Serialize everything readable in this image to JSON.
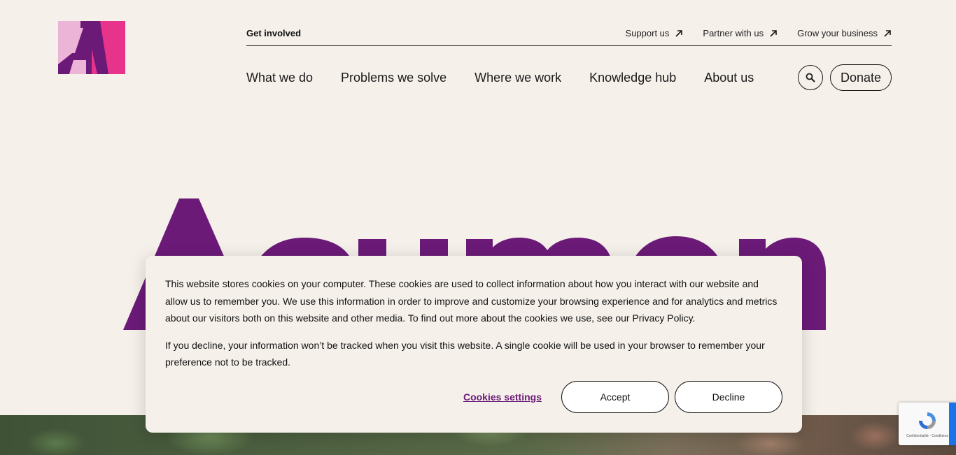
{
  "brand": {
    "name": "Acumen",
    "colors": {
      "purple": "#6b1a78",
      "pink": "#e8338b",
      "light_pink": "#ecb5d8",
      "bg": "#f5f0ea"
    }
  },
  "utility_nav": {
    "get_involved": "Get involved",
    "links": [
      {
        "label": "Support us",
        "icon": "arrow-up-right-icon"
      },
      {
        "label": "Partner with us",
        "icon": "arrow-up-right-icon"
      },
      {
        "label": "Grow your business",
        "icon": "arrow-up-right-icon"
      }
    ]
  },
  "main_nav": {
    "items": [
      "What we do",
      "Problems we solve",
      "Where we work",
      "Knowledge hub",
      "About us"
    ],
    "search_icon": "search-icon",
    "donate_label": "Donate"
  },
  "cookie_banner": {
    "paragraph_1": "This website stores cookies on your computer. These cookies are used to collect information about how you interact with our website and allow us to remember you. We use this information in order to improve and customize your browsing experience and for analytics and metrics about our visitors both on this website and other media. To find out more about the cookies we use, see our Privacy Policy.",
    "paragraph_2": "If you decline, your information won’t be tracked when you visit this website. A single cookie will be used in your browser to remember your preference not to be tracked.",
    "settings_label": "Cookies settings",
    "accept_label": "Accept",
    "decline_label": "Decline"
  },
  "recaptcha": {
    "text": "Confidentialité - Conditions"
  }
}
